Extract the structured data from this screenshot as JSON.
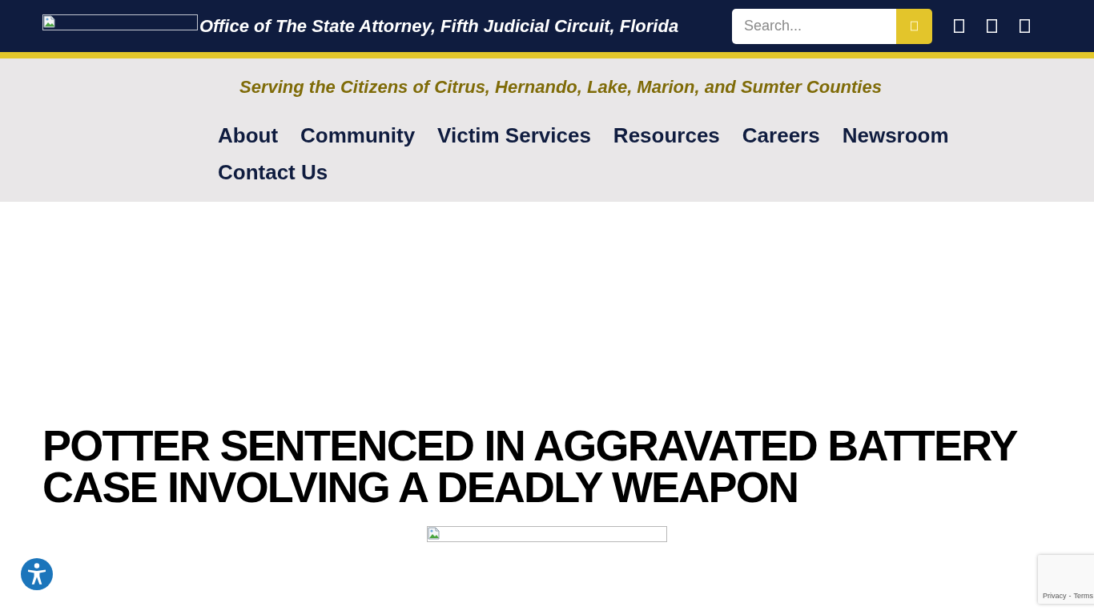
{
  "header": {
    "title": "Office of The State Attorney, Fifth Judicial Circuit, Florida",
    "search": {
      "placeholder": "Search..."
    }
  },
  "tagline": "Serving the Citizens of Citrus, Hernando, Lake, Marion, and Sumter Counties",
  "nav": {
    "items": [
      {
        "label": "About"
      },
      {
        "label": "Community"
      },
      {
        "label": "Victim Services"
      },
      {
        "label": "Resources"
      },
      {
        "label": "Careers"
      },
      {
        "label": "Newsroom"
      },
      {
        "label": "Contact Us"
      }
    ]
  },
  "article": {
    "headline": "POTTER SENTENCED IN AGGRAVATED BATTERY CASE INVOLVING A DEADLY WEAPON"
  },
  "recaptcha": {
    "links": [
      "Privacy",
      "Terms"
    ],
    "separator": "-"
  }
}
